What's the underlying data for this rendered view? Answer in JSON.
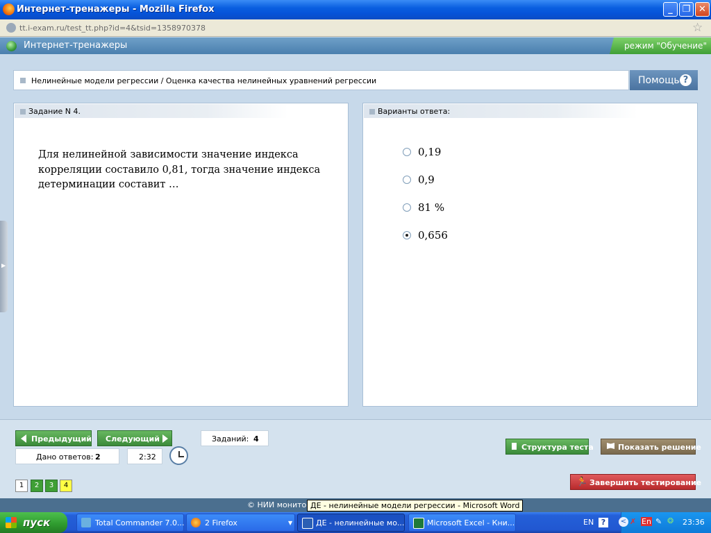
{
  "window": {
    "title": "Интернет-тренажеры - Mozilla Firefox"
  },
  "browser": {
    "url": "tt.i-exam.ru/test_tt.php?id=4&tsid=1358970378"
  },
  "app": {
    "name": "Интернет-тренажеры",
    "mode": "режим \"Обучение\""
  },
  "breadcrumb": "Нелинейные модели регрессии / Оценка качества нелинейных уравнений регрессии",
  "help_label": "Помощь",
  "help_icon": "?",
  "task": {
    "header": "Задание N 4.",
    "text": "Для нелинейной зависимости значение индекса корреляции составило 0,81, тогда значение индекса детерминации составит …"
  },
  "answers": {
    "header": "Варианты ответа:",
    "options": [
      {
        "label": "0,19",
        "selected": false
      },
      {
        "label": "0,9",
        "selected": false
      },
      {
        "label": "81 %",
        "selected": false
      },
      {
        "label": "0,656",
        "selected": true
      }
    ]
  },
  "nav": {
    "prev_label": "Предыдущий",
    "next_label": "Следующий",
    "tasks_count_label": "Заданий:",
    "tasks_count": "4",
    "answered_label": "Дано ответов:",
    "answered_count": "2",
    "timer": "2:32",
    "structure_label": "Структура теста",
    "solution_label": "Показать решение",
    "finish_label": "Завершить тестирование",
    "pages": [
      "1",
      "2",
      "3",
      "4"
    ]
  },
  "footer": {
    "copyright": "© НИИ монито"
  },
  "tooltip": "ДЕ - нелинейные модели регрессии - Microsoft Word",
  "taskbar": {
    "start_label": "пуск",
    "tasks": [
      {
        "label": "Total Commander 7.0..."
      },
      {
        "label": "2 Firefox"
      },
      {
        "label": "ДЕ - нелинейные мо..."
      },
      {
        "label": "Microsoft Excel - Кни..."
      }
    ],
    "lang": "EN",
    "tray_lang": "En",
    "clock": "23:36"
  },
  "colors": {
    "green_button": "#4a9e45",
    "brown_button": "#8a7a5e",
    "red_button": "#c9373a",
    "current_page": "#ffff44"
  }
}
